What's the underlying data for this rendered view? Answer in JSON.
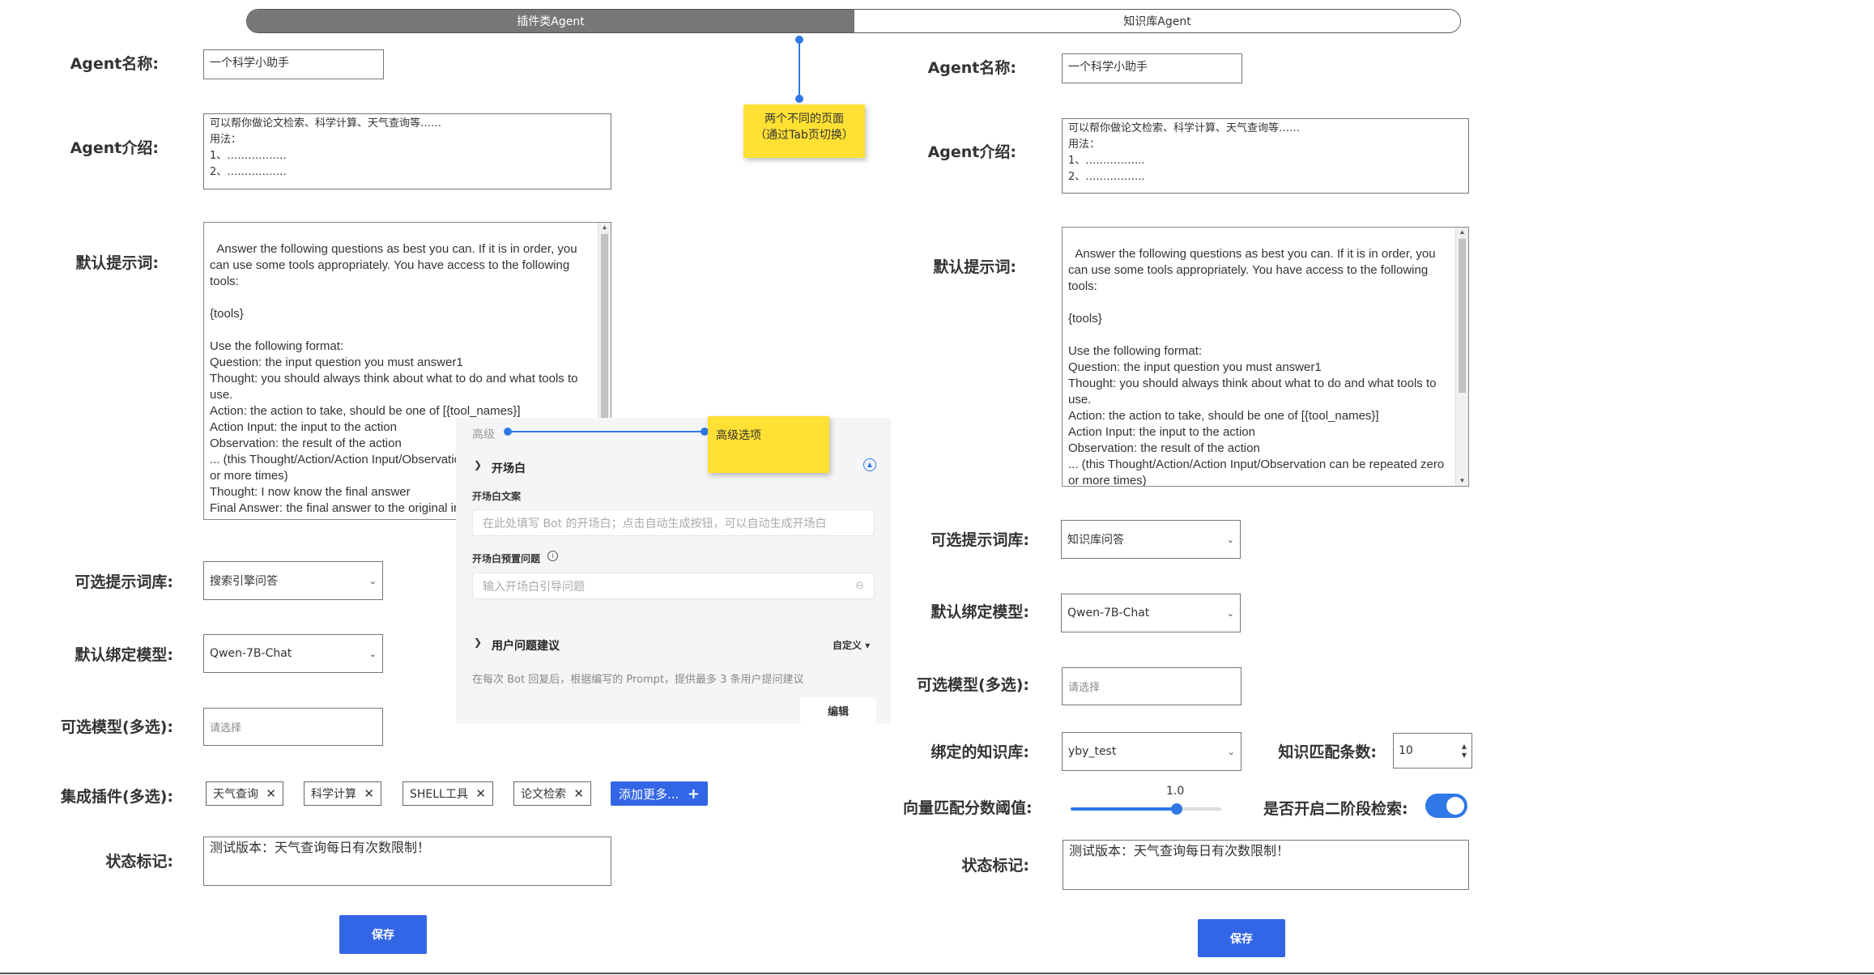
{
  "tabs": [
    {
      "label": "插件类Agent",
      "active": true
    },
    {
      "label": "知识库Agent",
      "active": false
    }
  ],
  "annotations": {
    "tab_note": "两个不同的页面\n（通过Tab页切换）",
    "adv_note": "高级选项"
  },
  "left": {
    "name_label": "Agent名称:",
    "name_value": "一个科学小助手",
    "intro_label": "Agent介绍:",
    "intro_value": "可以帮你做论文检索、科学计算、天气查询等……\n用法：\n1、……………..\n2、……………..",
    "prompt_label": "默认提示词:",
    "prompt_value": "Answer the following questions as best you can. If it is in order, you can use some tools appropriately. You have access to the following tools:\n\n{tools}\n\nUse the following format:\nQuestion: the input question you must answer1\nThought: you should always think about what to do and what tools to use.\nAction: the action to take, should be one of [{tool_names}]\nAction Input: the input to the action\nObservation: the result of the action\n... (this Thought/Action/Action Input/Observation can be repeated zero or more times)\nThought: I now know the final answer\nFinal Answer: the final answer to the original input question\nBegin!",
    "promptlib_label": "可选提示词库:",
    "promptlib_value": "搜索引擎问答",
    "model_label": "默认绑定模型:",
    "model_value": "Qwen-7B-Chat",
    "models_label": "可选模型(多选):",
    "models_placeholder": "请选择",
    "plugins_label": "集成插件(多选):",
    "plugins": [
      "天气查询",
      "科学计算",
      "SHELL工具",
      "论文检索"
    ],
    "add_more": "添加更多...",
    "status_label": "状态标记:",
    "status_value": "测试版本：天气查询每日有次数限制！",
    "save": "保存"
  },
  "right": {
    "name_label": "Agent名称:",
    "name_value": "一个科学小助手",
    "intro_label": "Agent介绍:",
    "intro_value": "可以帮你做论文检索、科学计算、天气查询等……\n用法：\n1、……………..\n2、……………..",
    "prompt_label": "默认提示词:",
    "prompt_value": "Answer the following questions as best you can. If it is in order, you can use some tools appropriately. You have access to the following tools:\n\n{tools}\n\nUse the following format:\nQuestion: the input question you must answer1\nThought: you should always think about what to do and what tools to use.\nAction: the action to take, should be one of [{tool_names}]\nAction Input: the input to the action\nObservation: the result of the action\n... (this Thought/Action/Action Input/Observation can be repeated zero or more times)\nThought: I now know the final answer",
    "promptlib_label": "可选提示词库:",
    "promptlib_value": "知识库问答",
    "model_label": "默认绑定模型:",
    "model_value": "Qwen-7B-Chat",
    "models_label": "可选模型(多选):",
    "models_placeholder": "请选择",
    "kb_label": "绑定的知识库:",
    "kb_value": "yby_test",
    "topk_label": "知识匹配条数:",
    "topk_value": "10",
    "threshold_label": "向量匹配分数阈值:",
    "threshold_value": "1.0",
    "threshold_fraction": 0.8,
    "twostage_label": "是否开启二阶段检索:",
    "twostage_on": true,
    "status_label": "状态标记:",
    "status_value": "测试版本：天气查询每日有次数限制！",
    "save": "保存"
  },
  "advanced": {
    "header": "高级",
    "opening_title": "开场白",
    "opening_text_label": "开场白文案",
    "opening_text_placeholder": "在此处填写 Bot 的开场白；点击自动生成按钮，可以自动生成开场白",
    "preset_q_label": "开场白预置问题",
    "preset_q_placeholder": "输入开场白引导问题",
    "suggest_title": "用户问题建议",
    "custom_label": "自定义",
    "suggest_desc": "在每次 Bot 回复后，根据编写的 Prompt，提供最多 3 条用户提问建议",
    "edit_button": "编辑"
  },
  "colors": {
    "accent": "#3366e6",
    "note": "#ffe033",
    "tab_active": "#777777"
  }
}
